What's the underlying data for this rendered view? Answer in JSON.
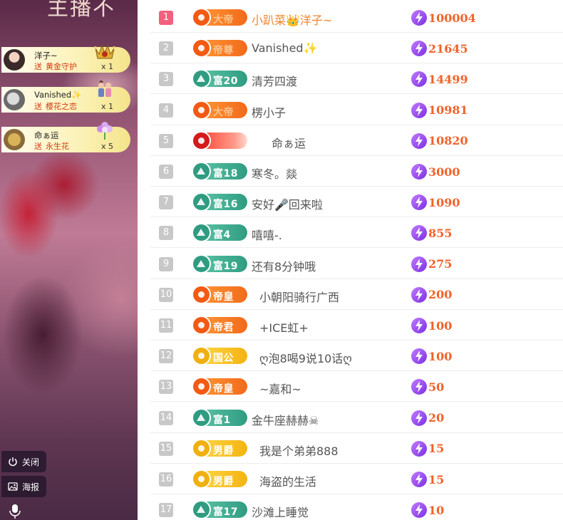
{
  "stream": {
    "title_fragment": "主播不",
    "gift_feed": [
      {
        "user": "洋子~",
        "send_label": "送",
        "gift": "黄金守护",
        "count": "x 1",
        "gift_icon": "gold-crown-icon"
      },
      {
        "user": "Vanished✨",
        "send_label": "送",
        "gift": "樱花之恋",
        "count": "x 1",
        "gift_icon": "couple-icon"
      },
      {
        "user": "命ぁ运",
        "send_label": "送",
        "gift": "永生花",
        "count": "x 5",
        "gift_icon": "flower-icon"
      }
    ],
    "controls": {
      "close_label": "关闭",
      "poster_label": "海报"
    }
  },
  "ranking": [
    {
      "rank": "1",
      "badge": "大帝",
      "badge_style": "orange-faded",
      "name": "小趴菜👑洋子~",
      "score": "100004"
    },
    {
      "rank": "2",
      "badge": "帝尊",
      "badge_style": "orange-faded",
      "name": "Vanished✨",
      "score": "21645"
    },
    {
      "rank": "3",
      "badge": "富20",
      "badge_style": "teal",
      "name": "清芳四渡",
      "score": "14499"
    },
    {
      "rank": "4",
      "badge": "大帝",
      "badge_style": "orange-faded",
      "name": "楞小子",
      "score": "10981"
    },
    {
      "rank": "5",
      "badge": "",
      "badge_style": "red",
      "name": "命ぁ运",
      "score": "10820"
    },
    {
      "rank": "6",
      "badge": "富18",
      "badge_style": "teal",
      "name": "寒冬。燚",
      "score": "3000"
    },
    {
      "rank": "7",
      "badge": "富16",
      "badge_style": "teal",
      "name": "安好🎤回来啦",
      "score": "1090"
    },
    {
      "rank": "8",
      "badge": "富4",
      "badge_style": "teal",
      "name": "嘻嘻-.",
      "score": "855"
    },
    {
      "rank": "9",
      "badge": "富19",
      "badge_style": "teal",
      "name": "还有8分钟哦",
      "score": "275"
    },
    {
      "rank": "10",
      "badge": "帝皇",
      "badge_style": "orange",
      "name": "小朝阳骑行广西",
      "score": "200"
    },
    {
      "rank": "11",
      "badge": "帝君",
      "badge_style": "orange",
      "name": "+ICE虹+",
      "score": "100"
    },
    {
      "rank": "12",
      "badge": "国公",
      "badge_style": "gold",
      "name": "ღ泡8喝9说10话ღ",
      "score": "100"
    },
    {
      "rank": "13",
      "badge": "帝皇",
      "badge_style": "orange",
      "name": "~嘉和~",
      "score": "50"
    },
    {
      "rank": "14",
      "badge": "富1",
      "badge_style": "teal",
      "name": "金牛座赫赫☠",
      "score": "20"
    },
    {
      "rank": "15",
      "badge": "男爵",
      "badge_style": "gold",
      "name": "我是个弟弟888",
      "score": "15"
    },
    {
      "rank": "16",
      "badge": "男爵",
      "badge_style": "gold",
      "name": "海盗的生活",
      "score": "15"
    },
    {
      "rank": "17",
      "badge": "富17",
      "badge_style": "teal",
      "name": "沙滩上睡觉",
      "score": "10"
    }
  ],
  "colors": {
    "accent_orange": "#f2622a",
    "rank_top": "#f2607e",
    "bolt_purple": "#7b2fe0"
  }
}
